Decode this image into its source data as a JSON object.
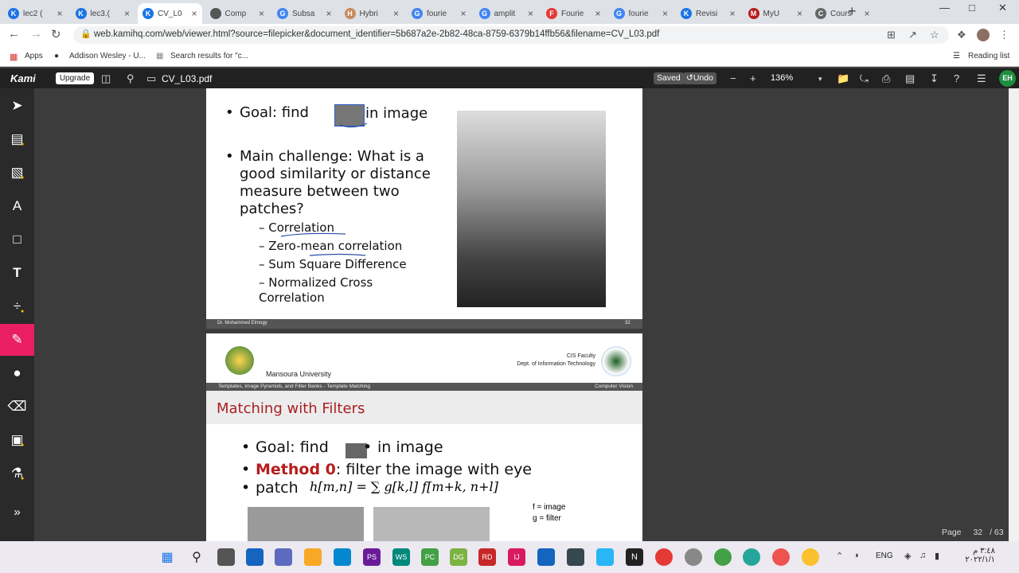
{
  "tabs": [
    {
      "title": "lec2 (",
      "favicon": "K",
      "color": "#1a73e8"
    },
    {
      "title": "lec3.(",
      "favicon": "K",
      "color": "#1a73e8"
    },
    {
      "title": "CV_L0",
      "favicon": "K",
      "color": "#1a73e8",
      "active": true
    },
    {
      "title": "Comp",
      "favicon": "globe",
      "color": "#555"
    },
    {
      "title": "Subsa",
      "favicon": "G",
      "color": "#4285f4"
    },
    {
      "title": "Hybri",
      "favicon": "H",
      "color": "#c98b5a"
    },
    {
      "title": "fourie",
      "favicon": "G",
      "color": "#4285f4"
    },
    {
      "title": "amplit",
      "favicon": "G",
      "color": "#4285f4"
    },
    {
      "title": "Fourie",
      "favicon": "F",
      "color": "#e53935"
    },
    {
      "title": "fourie",
      "favicon": "G",
      "color": "#4285f4"
    },
    {
      "title": "Revisi",
      "favicon": "K",
      "color": "#1a73e8"
    },
    {
      "title": "MyU",
      "favicon": "M",
      "color": "#b71c1c"
    },
    {
      "title": "Cours",
      "favicon": "C",
      "color": "#666"
    }
  ],
  "url": "web.kamihq.com/web/viewer.html?source=filepicker&document_identifier=5b687a2e-2b82-48ca-8759-6379b14ffb56&filename=CV_L03.pdf",
  "bookmarks": {
    "apps": "Apps",
    "b1": "Addison Wesley - U...",
    "b2": "Search results for \"c...",
    "reading": "Reading list"
  },
  "kami": {
    "logo": "Kami",
    "upgrade": "Upgrade",
    "filename": "CV_L03.pdf",
    "saved": "Saved",
    "undo": "Undo",
    "zoom": "136%",
    "avatar": "EH"
  },
  "slide1": {
    "goal_a": "Goal: find",
    "goal_b": "in image",
    "challenge": "Main challenge: What is a good similarity or distance measure between two patches?",
    "items": [
      "Correlation",
      "Zero-mean correlation",
      "Sum Square Difference",
      "Normalized Cross Correlation"
    ],
    "footer_author": "Dr. Mohammed Elmogy",
    "footer_page": "32"
  },
  "slide2": {
    "university": "Mansoura University",
    "faculty": "CIS Faculty",
    "dept": "Dept. of Information Technology",
    "bar_left": "Templates, Image Pyramids, and Filter Banks - Template Matching",
    "bar_right": "Computer Vision",
    "title": "Matching with Filters",
    "goal_a": "Goal: find",
    "goal_b": "in image",
    "method": "Method 0",
    "method_rest": ": filter the image with eye",
    "patch": "patch",
    "formula": "h[m,n] = ∑ g[k,l] f[m+k, n+l]",
    "f_note": "f = image",
    "g_note": "g = filter"
  },
  "page": {
    "label": "Page",
    "current": "32",
    "total": "/ 63"
  },
  "tray": {
    "lang": "ENG",
    "time": "٣:٤٨ م",
    "date": "٢٠٢٢/١/١"
  }
}
